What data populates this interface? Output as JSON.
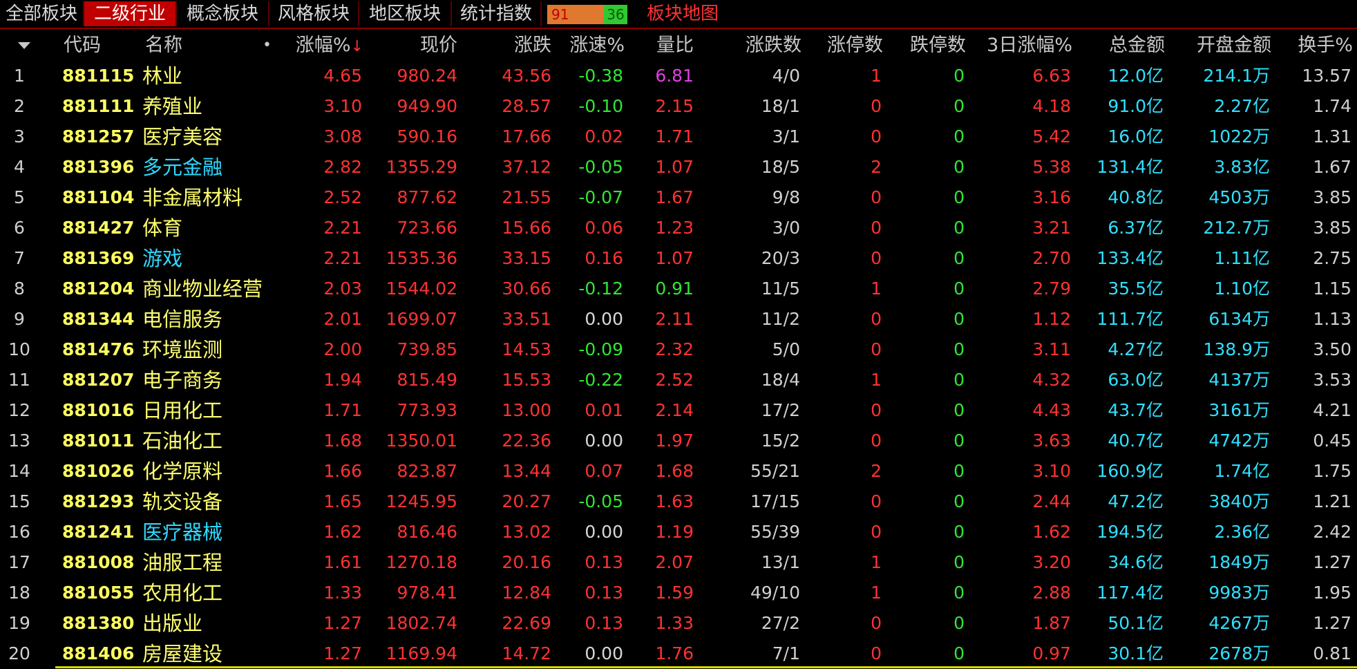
{
  "tabs": [
    {
      "label": "全部板块",
      "active": false
    },
    {
      "label": "二级行业",
      "active": true
    },
    {
      "label": "概念板块",
      "active": false
    },
    {
      "label": "风格板块",
      "active": false
    },
    {
      "label": "地区板块",
      "active": false
    },
    {
      "label": "统计指数",
      "active": false
    }
  ],
  "ratio": {
    "up": "91",
    "down": "36"
  },
  "map_link": "板块地图",
  "columns": {
    "code": "代码",
    "name": "名称",
    "pct": "涨幅%",
    "price": "现价",
    "chg": "涨跌",
    "speed": "涨速%",
    "vol_ratio": "量比",
    "up_down": "涨跌数",
    "limit_up": "涨停数",
    "limit_down": "跌停数",
    "d3": "3日涨幅%",
    "amount": "总金额",
    "open_amt": "开盘金额",
    "turnover": "换手%"
  },
  "colors": {
    "red": "#ff3232",
    "green": "#32e632",
    "white": "#d8d8d8",
    "magenta": "#e040e0",
    "cyan": "#30d8ff",
    "yellow": "#ffff70"
  },
  "rows": [
    {
      "idx": "1",
      "code": "881115",
      "name": "林业",
      "name_color": "yellow",
      "pct": "4.65",
      "price": "980.24",
      "chg": "43.56",
      "speed": "-0.38",
      "speed_color": "green",
      "vol_ratio": "6.81",
      "vr_color": "magenta",
      "up_down": "4/0",
      "limit_up": "1",
      "lu_color": "red",
      "limit_down": "0",
      "d3": "6.63",
      "amount": "12.0亿",
      "open_amt": "214.1万",
      "turnover": "13.57"
    },
    {
      "idx": "2",
      "code": "881111",
      "name": "养殖业",
      "name_color": "yellow",
      "pct": "3.10",
      "price": "949.90",
      "chg": "28.57",
      "speed": "-0.10",
      "speed_color": "green",
      "vol_ratio": "2.15",
      "vr_color": "red",
      "up_down": "18/1",
      "limit_up": "0",
      "lu_color": "red",
      "limit_down": "0",
      "d3": "4.18",
      "amount": "91.0亿",
      "open_amt": "2.27亿",
      "turnover": "1.74"
    },
    {
      "idx": "3",
      "code": "881257",
      "name": "医疗美容",
      "name_color": "yellow",
      "pct": "3.08",
      "price": "590.16",
      "chg": "17.66",
      "speed": "0.02",
      "speed_color": "red",
      "vol_ratio": "1.71",
      "vr_color": "red",
      "up_down": "3/1",
      "limit_up": "0",
      "lu_color": "red",
      "limit_down": "0",
      "d3": "5.42",
      "amount": "16.0亿",
      "open_amt": "1022万",
      "turnover": "1.31"
    },
    {
      "idx": "4",
      "code": "881396",
      "name": "多元金融",
      "name_color": "cyan",
      "pct": "2.82",
      "price": "1355.29",
      "chg": "37.12",
      "speed": "-0.05",
      "speed_color": "green",
      "vol_ratio": "1.07",
      "vr_color": "red",
      "up_down": "18/5",
      "limit_up": "2",
      "lu_color": "red",
      "limit_down": "0",
      "d3": "5.38",
      "amount": "131.4亿",
      "open_amt": "3.83亿",
      "turnover": "1.67"
    },
    {
      "idx": "5",
      "code": "881104",
      "name": "非金属材料",
      "name_color": "yellow",
      "pct": "2.52",
      "price": "877.62",
      "chg": "21.55",
      "speed": "-0.07",
      "speed_color": "green",
      "vol_ratio": "1.67",
      "vr_color": "red",
      "up_down": "9/8",
      "limit_up": "0",
      "lu_color": "red",
      "limit_down": "0",
      "d3": "3.16",
      "amount": "40.8亿",
      "open_amt": "4503万",
      "turnover": "3.85"
    },
    {
      "idx": "6",
      "code": "881427",
      "name": "体育",
      "name_color": "yellow",
      "pct": "2.21",
      "price": "723.66",
      "chg": "15.66",
      "speed": "0.06",
      "speed_color": "red",
      "vol_ratio": "1.23",
      "vr_color": "red",
      "up_down": "3/0",
      "limit_up": "0",
      "lu_color": "red",
      "limit_down": "0",
      "d3": "3.21",
      "amount": "6.37亿",
      "open_amt": "212.7万",
      "turnover": "3.85"
    },
    {
      "idx": "7",
      "code": "881369",
      "name": "游戏",
      "name_color": "cyan",
      "pct": "2.21",
      "price": "1535.36",
      "chg": "33.15",
      "speed": "0.16",
      "speed_color": "red",
      "vol_ratio": "1.07",
      "vr_color": "red",
      "up_down": "20/3",
      "limit_up": "0",
      "lu_color": "red",
      "limit_down": "0",
      "d3": "2.70",
      "amount": "133.4亿",
      "open_amt": "1.11亿",
      "turnover": "2.75"
    },
    {
      "idx": "8",
      "code": "881204",
      "name": "商业物业经营",
      "name_color": "yellow",
      "pct": "2.03",
      "price": "1544.02",
      "chg": "30.66",
      "speed": "-0.12",
      "speed_color": "green",
      "vol_ratio": "0.91",
      "vr_color": "green",
      "up_down": "11/5",
      "limit_up": "1",
      "lu_color": "red",
      "limit_down": "0",
      "d3": "2.79",
      "amount": "35.5亿",
      "open_amt": "1.10亿",
      "turnover": "1.15"
    },
    {
      "idx": "9",
      "code": "881344",
      "name": "电信服务",
      "name_color": "yellow",
      "pct": "2.01",
      "price": "1699.07",
      "chg": "33.51",
      "speed": "0.00",
      "speed_color": "white",
      "vol_ratio": "2.11",
      "vr_color": "red",
      "up_down": "11/2",
      "limit_up": "0",
      "lu_color": "red",
      "limit_down": "0",
      "d3": "1.12",
      "amount": "111.7亿",
      "open_amt": "6134万",
      "turnover": "1.13"
    },
    {
      "idx": "10",
      "code": "881476",
      "name": "环境监测",
      "name_color": "yellow",
      "pct": "2.00",
      "price": "739.85",
      "chg": "14.53",
      "speed": "-0.09",
      "speed_color": "green",
      "vol_ratio": "2.32",
      "vr_color": "red",
      "up_down": "5/0",
      "limit_up": "0",
      "lu_color": "red",
      "limit_down": "0",
      "d3": "3.11",
      "amount": "4.27亿",
      "open_amt": "138.9万",
      "turnover": "3.50"
    },
    {
      "idx": "11",
      "code": "881207",
      "name": "电子商务",
      "name_color": "yellow",
      "pct": "1.94",
      "price": "815.49",
      "chg": "15.53",
      "speed": "-0.22",
      "speed_color": "green",
      "vol_ratio": "2.52",
      "vr_color": "red",
      "up_down": "18/4",
      "limit_up": "1",
      "lu_color": "red",
      "limit_down": "0",
      "d3": "4.32",
      "amount": "63.0亿",
      "open_amt": "4137万",
      "turnover": "3.53"
    },
    {
      "idx": "12",
      "code": "881016",
      "name": "日用化工",
      "name_color": "yellow",
      "pct": "1.71",
      "price": "773.93",
      "chg": "13.00",
      "speed": "0.01",
      "speed_color": "red",
      "vol_ratio": "2.14",
      "vr_color": "red",
      "up_down": "17/2",
      "limit_up": "0",
      "lu_color": "red",
      "limit_down": "0",
      "d3": "4.43",
      "amount": "43.7亿",
      "open_amt": "3161万",
      "turnover": "4.21"
    },
    {
      "idx": "13",
      "code": "881011",
      "name": "石油化工",
      "name_color": "yellow",
      "pct": "1.68",
      "price": "1350.01",
      "chg": "22.36",
      "speed": "0.00",
      "speed_color": "white",
      "vol_ratio": "1.97",
      "vr_color": "red",
      "up_down": "15/2",
      "limit_up": "0",
      "lu_color": "red",
      "limit_down": "0",
      "d3": "3.63",
      "amount": "40.7亿",
      "open_amt": "4742万",
      "turnover": "0.45"
    },
    {
      "idx": "14",
      "code": "881026",
      "name": "化学原料",
      "name_color": "yellow",
      "pct": "1.66",
      "price": "823.87",
      "chg": "13.44",
      "speed": "0.07",
      "speed_color": "red",
      "vol_ratio": "1.68",
      "vr_color": "red",
      "up_down": "55/21",
      "limit_up": "2",
      "lu_color": "red",
      "limit_down": "0",
      "d3": "3.10",
      "amount": "160.9亿",
      "open_amt": "1.74亿",
      "turnover": "1.75"
    },
    {
      "idx": "15",
      "code": "881293",
      "name": "轨交设备",
      "name_color": "yellow",
      "pct": "1.65",
      "price": "1245.95",
      "chg": "20.27",
      "speed": "-0.05",
      "speed_color": "green",
      "vol_ratio": "1.63",
      "vr_color": "red",
      "up_down": "17/15",
      "limit_up": "0",
      "lu_color": "red",
      "limit_down": "0",
      "d3": "2.44",
      "amount": "47.2亿",
      "open_amt": "3840万",
      "turnover": "1.21"
    },
    {
      "idx": "16",
      "code": "881241",
      "name": "医疗器械",
      "name_color": "cyan",
      "pct": "1.62",
      "price": "816.46",
      "chg": "13.02",
      "speed": "0.00",
      "speed_color": "white",
      "vol_ratio": "1.19",
      "vr_color": "red",
      "up_down": "55/39",
      "limit_up": "0",
      "lu_color": "red",
      "limit_down": "0",
      "d3": "1.62",
      "amount": "194.5亿",
      "open_amt": "2.36亿",
      "turnover": "2.42"
    },
    {
      "idx": "17",
      "code": "881008",
      "name": "油服工程",
      "name_color": "yellow",
      "pct": "1.61",
      "price": "1270.18",
      "chg": "20.16",
      "speed": "0.13",
      "speed_color": "red",
      "vol_ratio": "2.07",
      "vr_color": "red",
      "up_down": "13/1",
      "limit_up": "1",
      "lu_color": "red",
      "limit_down": "0",
      "d3": "3.20",
      "amount": "34.6亿",
      "open_amt": "1849万",
      "turnover": "1.27"
    },
    {
      "idx": "18",
      "code": "881055",
      "name": "农用化工",
      "name_color": "yellow",
      "pct": "1.33",
      "price": "978.41",
      "chg": "12.84",
      "speed": "0.13",
      "speed_color": "red",
      "vol_ratio": "1.59",
      "vr_color": "red",
      "up_down": "49/10",
      "limit_up": "1",
      "lu_color": "red",
      "limit_down": "0",
      "d3": "2.88",
      "amount": "117.4亿",
      "open_amt": "9983万",
      "turnover": "1.95"
    },
    {
      "idx": "19",
      "code": "881380",
      "name": "出版业",
      "name_color": "yellow",
      "pct": "1.27",
      "price": "1802.74",
      "chg": "22.69",
      "speed": "0.13",
      "speed_color": "red",
      "vol_ratio": "1.33",
      "vr_color": "red",
      "up_down": "27/2",
      "limit_up": "0",
      "lu_color": "red",
      "limit_down": "0",
      "d3": "1.87",
      "amount": "50.1亿",
      "open_amt": "4267万",
      "turnover": "1.27"
    },
    {
      "idx": "20",
      "code": "881406",
      "name": "房屋建设",
      "name_color": "yellow",
      "pct": "1.27",
      "price": "1169.94",
      "chg": "14.72",
      "speed": "0.00",
      "speed_color": "white",
      "vol_ratio": "1.76",
      "vr_color": "red",
      "up_down": "7/1",
      "limit_up": "0",
      "lu_color": "red",
      "limit_down": "0",
      "d3": "0.97",
      "amount": "30.1亿",
      "open_amt": "2678万",
      "turnover": "0.81"
    }
  ]
}
